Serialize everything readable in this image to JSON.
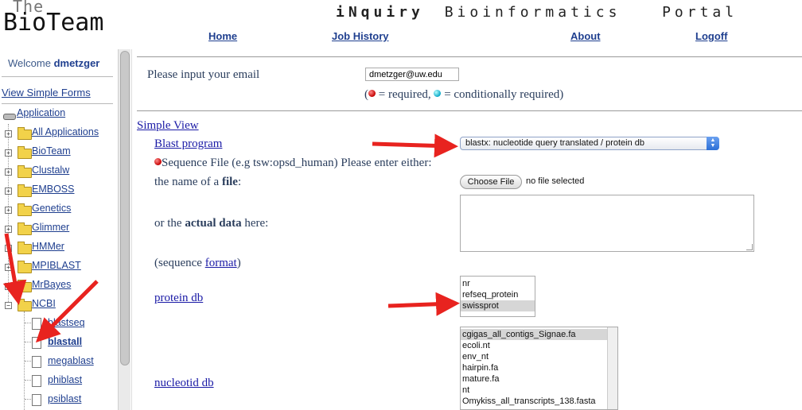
{
  "header": {
    "logo_top": "The",
    "logo_bottom": "BioTeam",
    "portal_title_bold": "iNquiry",
    "portal_title_rest": " Bioinformatics  Portal",
    "nav": [
      "Home",
      "Job History",
      "About",
      "Logoff"
    ]
  },
  "sidebar": {
    "welcome_prefix": "Welcome ",
    "username": "dmetzger",
    "simple_forms": "View Simple Forms",
    "application": "Application",
    "folders": [
      "All Applications",
      "BioTeam",
      "Clustalw",
      "EMBOSS",
      "Genetics",
      "Glimmer",
      "HMMer",
      "MPIBLAST",
      "MrBayes",
      "NCBI"
    ],
    "ncbi_items": [
      "blastseq",
      "blastall",
      "megablast",
      "phiblast",
      "psiblast"
    ]
  },
  "form": {
    "email_label": "Please input your email",
    "email_value": "dmetzger@uw.edu",
    "legend_open": "(",
    "legend_required": " = required, ",
    "legend_conditional": " = conditionally required)",
    "simple_view": "Simple View",
    "blast_program_label": "Blast program",
    "blast_program_value": "blastx: nucleotide query translated / protein db",
    "sequence_label": "Sequence File (e.g tsw:opsd_human) Please enter either:",
    "file_label_prefix": "the name of a ",
    "file_label_bold": "file",
    "file_label_suffix": ":",
    "choose_file": "Choose File",
    "no_file": "no file selected",
    "actual_prefix": "or the ",
    "actual_bold": "actual data",
    "actual_suffix": " here:",
    "seq_format_prefix": "(sequence ",
    "seq_format_link": "format",
    "seq_format_suffix": ")",
    "protein_db_label": "protein db",
    "protein_db_options": [
      "nr",
      "refseq_protein",
      "swissprot"
    ],
    "protein_db_selected": "swissprot",
    "nucleotid_db_label": "nucleotid db",
    "nucleotid_db_options": [
      "cgigas_all_contigs_Signae.fa",
      "ecoli.nt",
      "env_nt",
      "hairpin.fa",
      "mature.fa",
      "nt",
      "Omykiss_all_transcripts_138.fasta"
    ],
    "nucleotid_db_selected": "cgigas_all_contigs_Signae.fa"
  },
  "colors": {
    "link": "#1f3f8f",
    "annotation_arrow": "#e8231f",
    "required_dot": "#c40000",
    "conditional_dot": "#0aa8c8"
  }
}
